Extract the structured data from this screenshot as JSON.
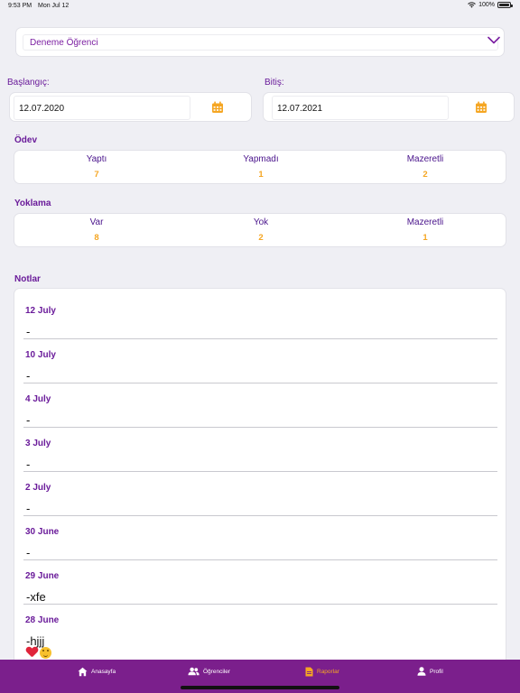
{
  "status_bar": {
    "time": "9:53 PM",
    "date": "Mon Jul 12",
    "battery": "100%"
  },
  "student_select": {
    "value": "Deneme Öğrenci"
  },
  "date_range": {
    "start_label": "Başlangıç:",
    "start_value": "12.07.2020",
    "end_label": "Bitiş:",
    "end_value": "12.07.2021"
  },
  "homework": {
    "title": "Ödev",
    "stats": [
      {
        "label": "Yaptı",
        "value": "7"
      },
      {
        "label": "Yapmadı",
        "value": "1"
      },
      {
        "label": "Mazeretli",
        "value": "2"
      }
    ]
  },
  "attendance": {
    "title": "Yoklama",
    "stats": [
      {
        "label": "Var",
        "value": "8"
      },
      {
        "label": "Yok",
        "value": "2"
      },
      {
        "label": "Mazeretli",
        "value": "1"
      }
    ]
  },
  "notes": {
    "title": "Notlar",
    "items": [
      {
        "date": "12 July",
        "text": "-"
      },
      {
        "date": "10 July",
        "text": "-"
      },
      {
        "date": "4 July",
        "text": "-"
      },
      {
        "date": "3 July",
        "text": "-"
      },
      {
        "date": "2 July",
        "text": "-"
      },
      {
        "date": "30 June",
        "text": "-"
      },
      {
        "date": "29 June",
        "text": "-xfe"
      },
      {
        "date": "28 June",
        "text": "-hjjj",
        "emojis": [
          "heart-emoji",
          "upside-down-face-emoji"
        ]
      }
    ]
  },
  "tab_bar": {
    "tabs": [
      {
        "label": "Anasayfa",
        "icon": "home-icon",
        "active": false
      },
      {
        "label": "Öğrenciler",
        "icon": "users-icon",
        "active": false
      },
      {
        "label": "Raporlar",
        "icon": "report-icon",
        "active": true
      },
      {
        "label": "Profil",
        "icon": "person-icon",
        "active": false
      }
    ]
  },
  "colors": {
    "accent_purple": "#6a1b9a",
    "tab_bar": "#7b1f8c",
    "highlight_orange": "#f5a623",
    "background": "#efeff4"
  }
}
